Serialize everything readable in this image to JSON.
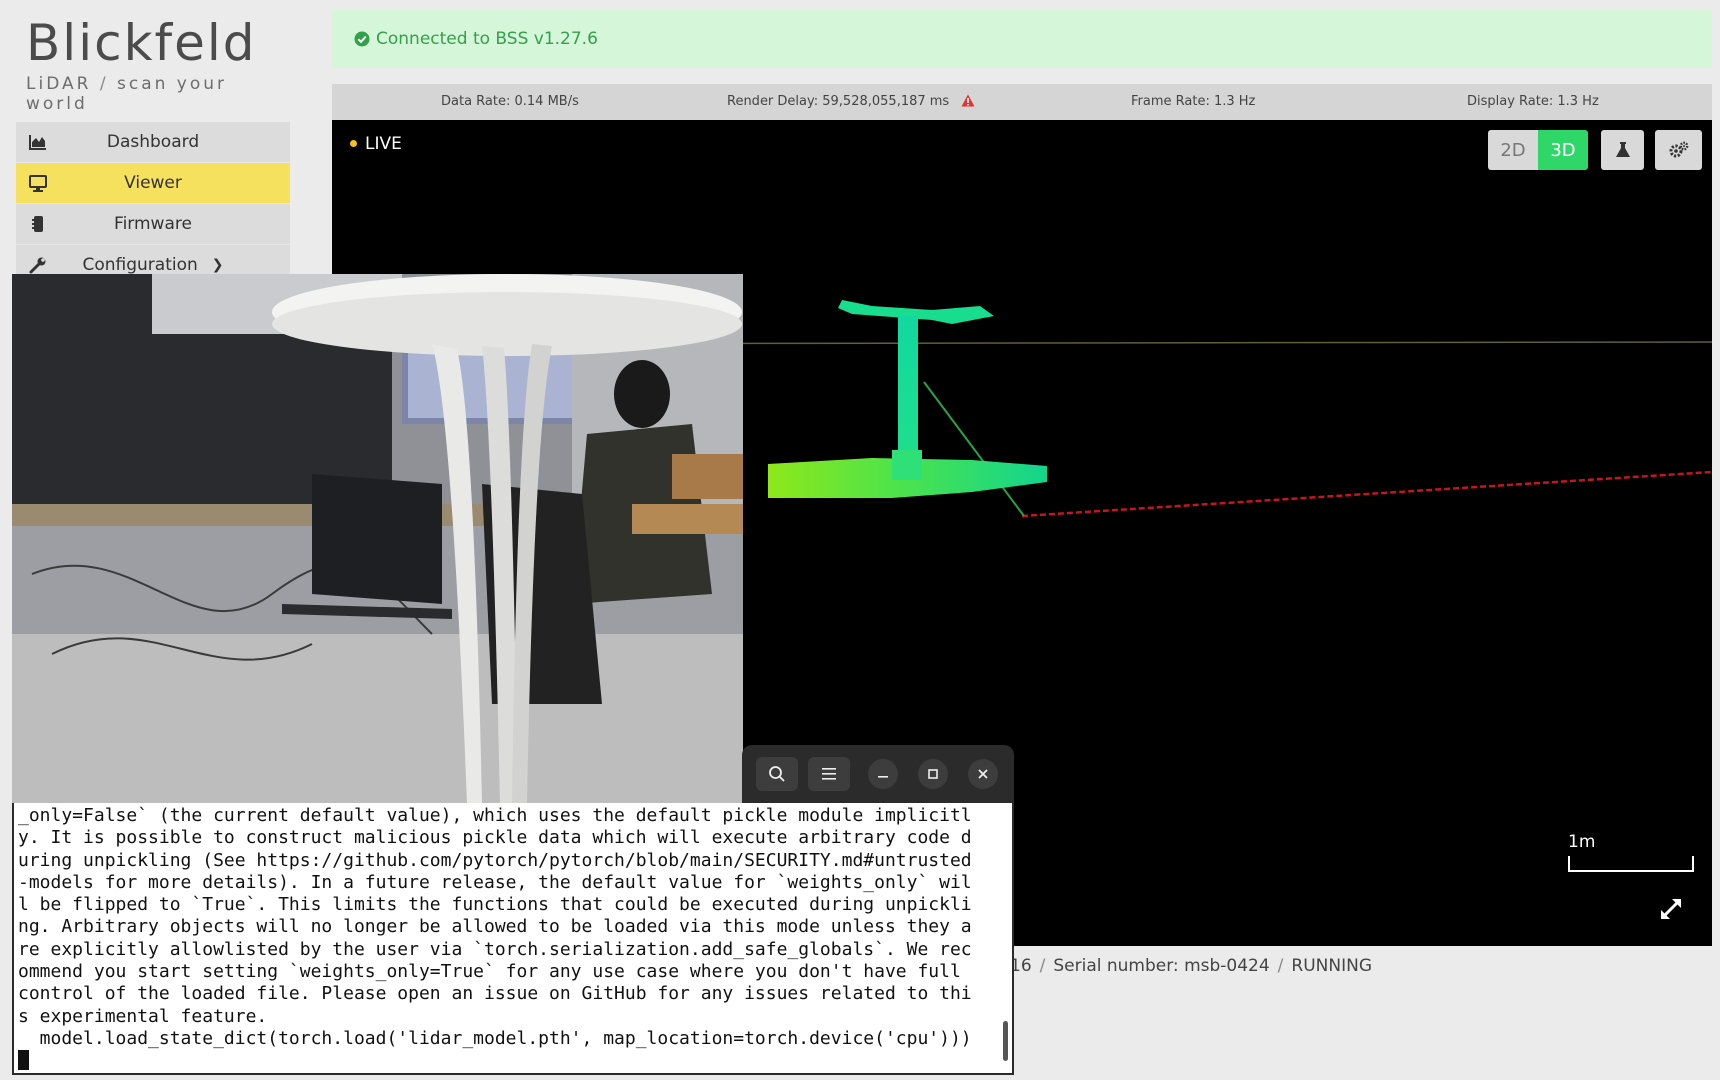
{
  "brand": {
    "name": "Blickfeld",
    "tagline_left": "LiDAR",
    "tagline_sep": "/",
    "tagline_right": "scan your world"
  },
  "nav": {
    "items": [
      {
        "label": "Dashboard",
        "icon": "area-chart-icon",
        "active": false
      },
      {
        "label": "Viewer",
        "icon": "monitor-icon",
        "active": true
      },
      {
        "label": "Firmware",
        "icon": "chip-icon",
        "active": false
      },
      {
        "label": "Configuration",
        "icon": "wrench-icon",
        "active": false,
        "has_submenu": true
      }
    ]
  },
  "connection": {
    "message": "Connected to BSS v1.27.6",
    "icon": "check-circle-icon",
    "color": "#33a04a"
  },
  "stats": {
    "data_rate": "Data Rate: 0.14 MB/s",
    "render_delay": "Render Delay: 59,528,055,187 ms",
    "frame_rate": "Frame Rate: 1.3 Hz",
    "display_rate": "Display Rate: 1.3 Hz",
    "render_delay_warning_icon": "warning-triangle-icon"
  },
  "viewer": {
    "live_label": "LIVE",
    "mode_2d": "2D",
    "mode_3d": "3D",
    "active_mode": "3D",
    "scale_label": "1m",
    "accent_color": "#2fd768"
  },
  "device": {
    "version_fragment": "16",
    "serial": "Serial number: msb-0424",
    "state": "RUNNING",
    "sep": "/"
  },
  "terminal": {
    "lines": [
      "_only=False` (the current default value), which uses the default pickle module implicitl",
      "y. It is possible to construct malicious pickle data which will execute arbitrary code d",
      "uring unpickling (See https://github.com/pytorch/pytorch/blob/main/SECURITY.md#untrusted",
      "-models for more details). In a future release, the default value for `weights_only` wil",
      "l be flipped to `True`. This limits the functions that could be executed during unpickli",
      "ng. Arbitrary objects will no longer be allowed to be loaded via this mode unless they a",
      "re explicitly allowlisted by the user via `torch.serialization.add_safe_globals`. We rec",
      "ommend you start setting `weights_only=True` for any use case where you don't have full",
      "control of the loaded file. Please open an issue on GitHub for any issues related to thi",
      "s experimental feature.",
      "  model.load_state_dict(torch.load('lidar_model.pth', map_location=torch.device('cpu')))"
    ]
  }
}
